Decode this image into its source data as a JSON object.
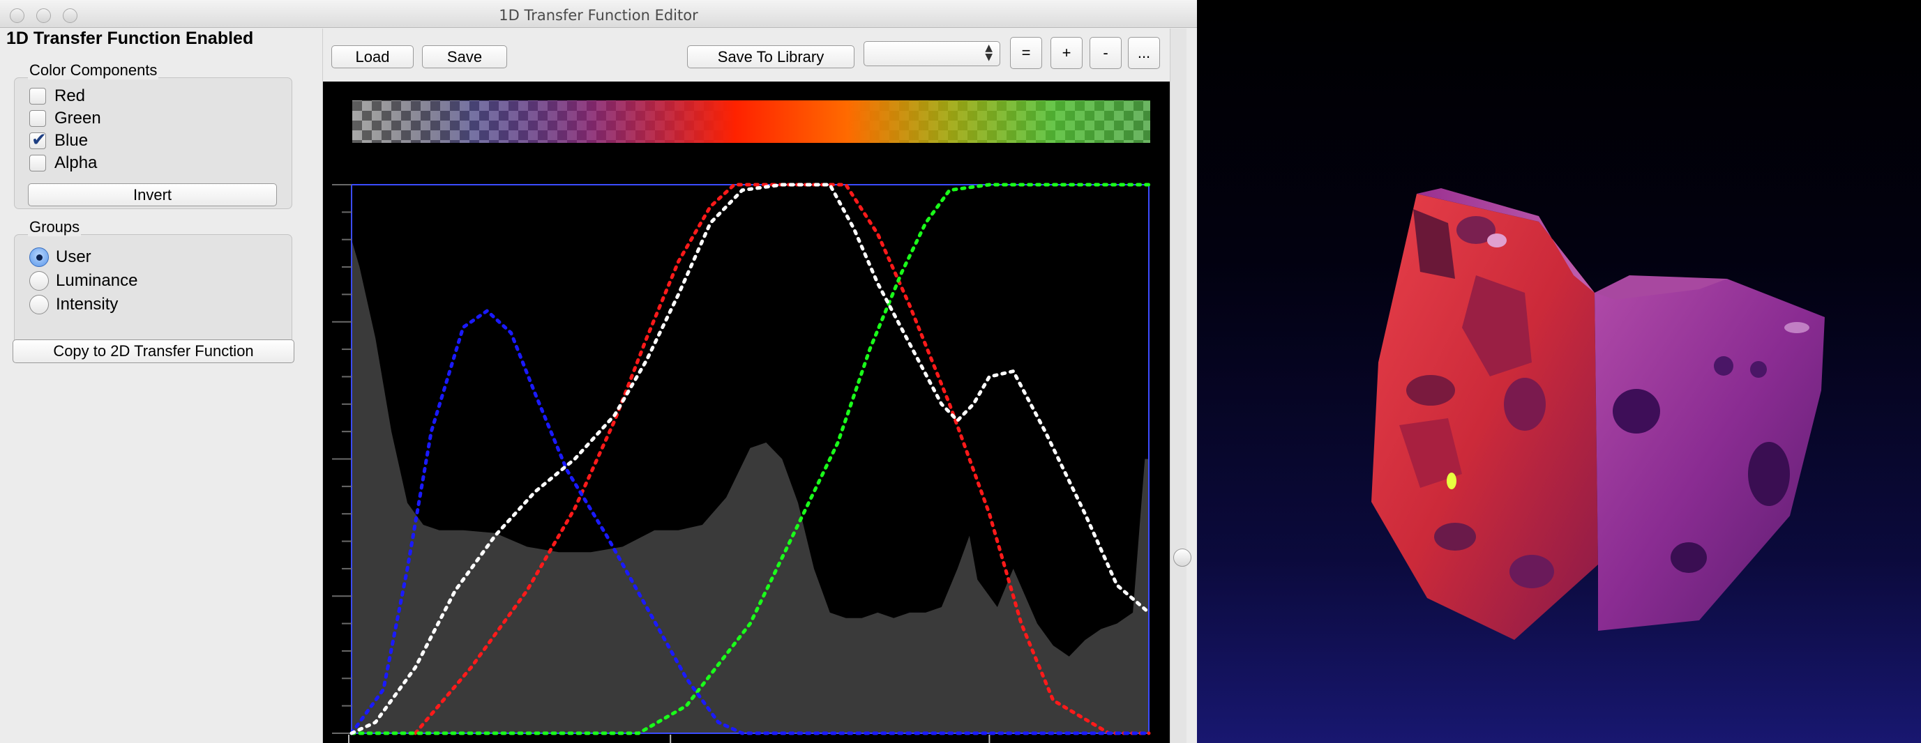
{
  "window": {
    "title": "1D Transfer Function Editor"
  },
  "left_panel": {
    "status": "1D Transfer Function Enabled",
    "color_components": {
      "title": "Color Components",
      "items": [
        {
          "label": "Red",
          "checked": false
        },
        {
          "label": "Green",
          "checked": false
        },
        {
          "label": "Blue",
          "checked": true
        },
        {
          "label": "Alpha",
          "checked": false
        }
      ],
      "invert_label": "Invert"
    },
    "groups": {
      "title": "Groups",
      "items": [
        {
          "label": "User",
          "selected": true
        },
        {
          "label": "Luminance",
          "selected": false
        },
        {
          "label": "Intensity",
          "selected": false
        }
      ]
    },
    "copy_label": "Copy to 2D Transfer Function"
  },
  "toolbar": {
    "load_label": "Load",
    "save_label": "Save",
    "save_library_label": "Save To Library",
    "library_value": "",
    "equal_label": "=",
    "plus_label": "+",
    "minus_label": "-",
    "more_label": "..."
  },
  "colors": {
    "red_curve": "#ff1a1a",
    "green_curve": "#1aff1a",
    "blue_curve": "#1a1aff",
    "alpha_curve": "#ffffff",
    "histogram": "#3a3a3a",
    "frame": "#3b4cff"
  },
  "chart_data": {
    "type": "line",
    "xlim": [
      0,
      1
    ],
    "ylim": [
      0,
      1
    ],
    "grid": false,
    "histogram": {
      "x": [
        0,
        0.01,
        0.03,
        0.05,
        0.07,
        0.09,
        0.11,
        0.14,
        0.18,
        0.22,
        0.26,
        0.3,
        0.34,
        0.38,
        0.41,
        0.44,
        0.47,
        0.5,
        0.52,
        0.54,
        0.56,
        0.58,
        0.6,
        0.62,
        0.64,
        0.66,
        0.68,
        0.7,
        0.72,
        0.74,
        0.76,
        0.775,
        0.785,
        0.795,
        0.81,
        0.83,
        0.845,
        0.86,
        0.88,
        0.9,
        0.92,
        0.94,
        0.96,
        0.98,
        0.995,
        1
      ],
      "y": [
        0.9,
        0.85,
        0.72,
        0.55,
        0.42,
        0.38,
        0.37,
        0.37,
        0.365,
        0.34,
        0.33,
        0.33,
        0.34,
        0.37,
        0.37,
        0.38,
        0.43,
        0.52,
        0.53,
        0.5,
        0.42,
        0.3,
        0.22,
        0.21,
        0.21,
        0.22,
        0.21,
        0.22,
        0.22,
        0.23,
        0.3,
        0.36,
        0.28,
        0.26,
        0.23,
        0.3,
        0.25,
        0.2,
        0.16,
        0.14,
        0.17,
        0.19,
        0.2,
        0.22,
        0.5,
        0.5
      ]
    },
    "series": [
      {
        "key": "red",
        "x": [
          0.08,
          0.15,
          0.22,
          0.28,
          0.33,
          0.37,
          0.41,
          0.45,
          0.48,
          0.62,
          0.66,
          0.7,
          0.75,
          0.8,
          0.84,
          0.88,
          0.95,
          1.0
        ],
        "y": [
          0.0,
          0.12,
          0.26,
          0.41,
          0.57,
          0.72,
          0.86,
          0.96,
          1.0,
          1.0,
          0.91,
          0.78,
          0.6,
          0.4,
          0.2,
          0.06,
          0.0,
          0.0
        ]
      },
      {
        "key": "green",
        "x": [
          0.0,
          0.36,
          0.42,
          0.5,
          0.56,
          0.61,
          0.65,
          0.69,
          0.72,
          0.75,
          0.8,
          1.0
        ],
        "y": [
          0.0,
          0.0,
          0.05,
          0.2,
          0.38,
          0.53,
          0.7,
          0.84,
          0.93,
          0.99,
          1.0,
          1.0
        ]
      },
      {
        "key": "blue",
        "x": [
          0.0,
          0.04,
          0.07,
          0.1,
          0.14,
          0.17,
          0.2,
          0.23,
          0.27,
          0.32,
          0.37,
          0.42,
          0.46,
          0.49,
          0.5,
          1.0
        ],
        "y": [
          0.0,
          0.08,
          0.3,
          0.55,
          0.74,
          0.77,
          0.73,
          0.62,
          0.48,
          0.36,
          0.23,
          0.1,
          0.02,
          0.0,
          0.0,
          0.0
        ]
      },
      {
        "key": "alpha",
        "x": [
          0.0,
          0.03,
          0.08,
          0.13,
          0.18,
          0.23,
          0.28,
          0.33,
          0.37,
          0.41,
          0.45,
          0.49,
          0.54,
          0.6,
          0.63,
          0.66,
          0.7,
          0.74,
          0.76,
          0.78,
          0.8,
          0.83,
          0.87,
          0.92,
          0.96,
          1.0
        ],
        "y": [
          0.0,
          0.02,
          0.12,
          0.26,
          0.36,
          0.44,
          0.5,
          0.58,
          0.68,
          0.8,
          0.93,
          0.99,
          1.0,
          1.0,
          0.92,
          0.82,
          0.71,
          0.6,
          0.57,
          0.6,
          0.65,
          0.66,
          0.55,
          0.4,
          0.27,
          0.22
        ]
      }
    ]
  }
}
